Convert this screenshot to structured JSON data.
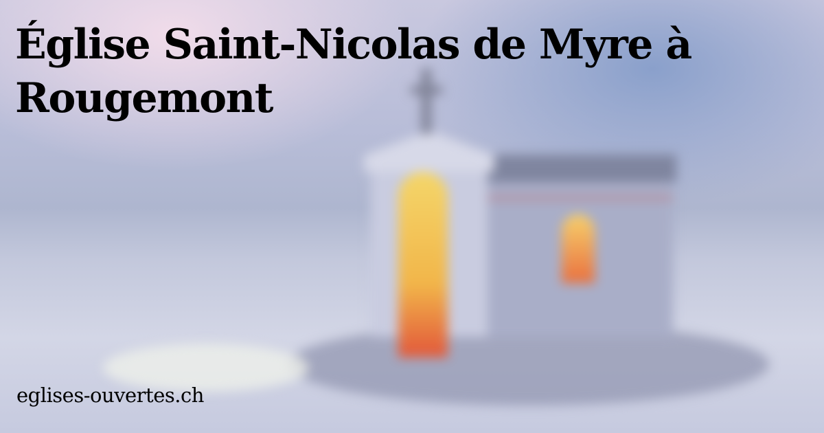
{
  "title": "Église Saint-Nicolas de Myre à Rougemont",
  "site": "eglises-ouvertes.ch",
  "colors": {
    "text": "#000000",
    "sky": "#b8bdd8",
    "door_light": "#f2b64a"
  },
  "image": {
    "subject": "chapel-in-snow"
  }
}
